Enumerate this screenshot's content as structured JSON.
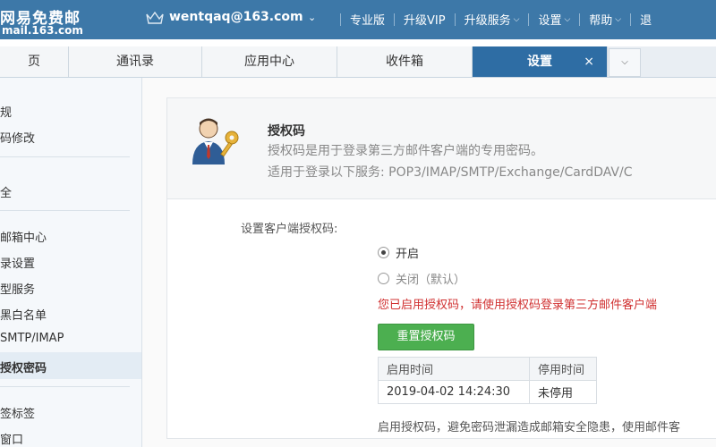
{
  "header": {
    "logo_name": "网易免费邮",
    "logo_domain": "mail.163.com",
    "account_email": "wentqaq@163.com",
    "nav": [
      {
        "label": "专业版",
        "dropdown": false
      },
      {
        "label": "升级VIP",
        "dropdown": false
      },
      {
        "label": "升级服务",
        "dropdown": true
      },
      {
        "label": "设置",
        "dropdown": true
      },
      {
        "label": "帮助",
        "dropdown": true
      },
      {
        "label": "退",
        "dropdown": false
      }
    ]
  },
  "tabs": [
    {
      "label": "页",
      "active": false
    },
    {
      "label": "通讯录",
      "active": false
    },
    {
      "label": "应用中心",
      "active": false
    },
    {
      "label": "收件箱",
      "active": false
    },
    {
      "label": "设置",
      "active": true,
      "close": "×"
    }
  ],
  "sidebar": {
    "items": [
      {
        "label": "规"
      },
      {
        "label": "码修改"
      },
      {
        "label": "全"
      },
      {
        "label": "邮箱中心"
      },
      {
        "label": "录设置"
      },
      {
        "label": "型服务"
      },
      {
        "label": "黑白名单"
      },
      {
        "label": "SMTP/IMAP"
      },
      {
        "label": "授权密码",
        "active": true
      },
      {
        "label": "签标签"
      },
      {
        "label": "窗口"
      }
    ]
  },
  "auth_code": {
    "title": "授权码",
    "desc_line1": "授权码是用于登录第三方邮件客户端的专用密码。",
    "desc_line2": "适用于登录以下服务: POP3/IMAP/SMTP/Exchange/CardDAV/C",
    "setting_label": "设置客户端授权码:",
    "option_on": "开启",
    "option_off": "关闭（默认）",
    "selected": "开启",
    "status_hint": "您已启用授权码，请使用授权码登录第三方邮件客户端",
    "reset_button": "重置授权码",
    "table": {
      "headers": [
        "启用时间",
        "停用时间"
      ],
      "rows": [
        [
          "2019-04-02 14:24:30",
          "未停用"
        ]
      ]
    },
    "bottom_note": "启用授权码，避免密码泄漏造成邮箱安全隐患，使用邮件客"
  },
  "colors": {
    "header_bg": "#3d78a8",
    "active_tab_bg": "#2e6da4",
    "warning_text": "#d03030",
    "primary_button": "#4caf50"
  }
}
